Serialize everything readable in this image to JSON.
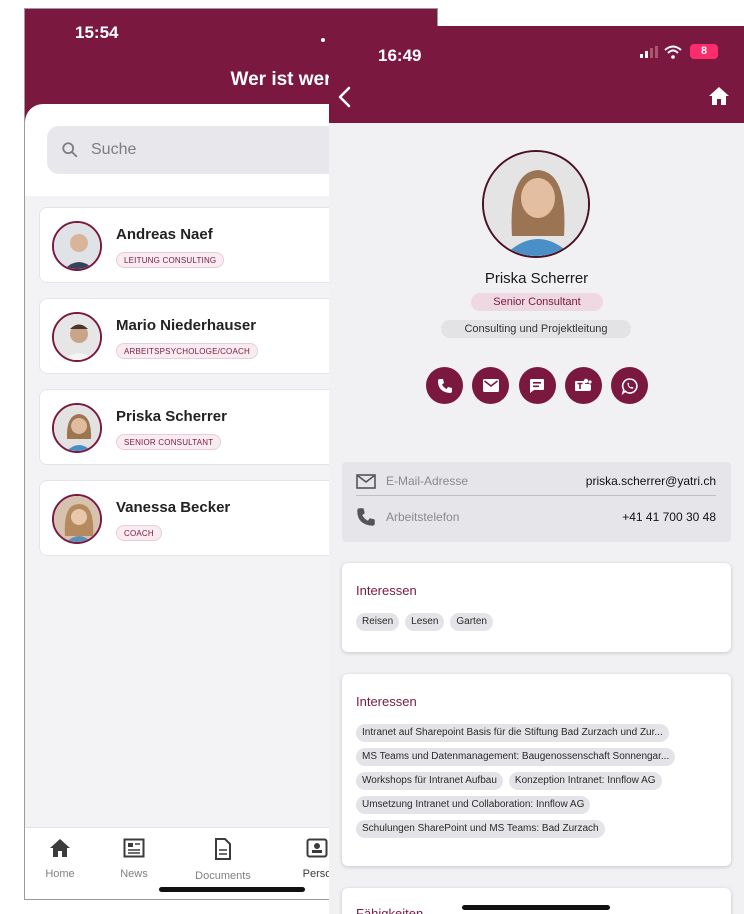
{
  "list_screen": {
    "time": "15:54",
    "title": "Wer ist wer",
    "search": {
      "placeholder": "Suche"
    },
    "people": [
      {
        "name": "Andreas Naef",
        "role": "LEITUNG CONSULTING"
      },
      {
        "name": "Mario Niederhauser",
        "role": "ARBEITSPSYCHOLOGE/COACH"
      },
      {
        "name": "Priska Scherrer",
        "role": "SENIOR CONSULTANT"
      },
      {
        "name": "Vanessa Becker",
        "role": "COACH"
      }
    ],
    "tabs": [
      {
        "label": "Home",
        "icon": "home-icon"
      },
      {
        "label": "News",
        "icon": "news-icon"
      },
      {
        "label": "Documents",
        "icon": "document-icon"
      },
      {
        "label": "Perso",
        "icon": "person-card-icon"
      }
    ]
  },
  "detail_screen": {
    "time": "16:49",
    "battery": "8",
    "profile": {
      "name": "Priska Scherrer",
      "role": "Senior Consultant",
      "department": "Consulting und Projektleitung"
    },
    "actions": [
      "phone-icon",
      "mail-icon",
      "chat-icon",
      "teams-icon",
      "whatsapp-icon"
    ],
    "contact": {
      "email_label": "E-Mail-Adresse",
      "email_value": "priska.scherrer@yatri.ch",
      "phone_label": "Arbeitstelefon",
      "phone_value": "+41 41 700 30 48"
    },
    "interests_1": {
      "title": "Interessen",
      "chips": [
        "Reisen",
        "Lesen",
        "Garten"
      ]
    },
    "interests_2": {
      "title": "Interessen",
      "chips": [
        "Intranet auf Sharepoint Basis für die Stiftung Bad Zurzach und Zur...",
        "MS Teams und Datenmanagement: Baugenossenschaft Sonnengar...",
        "Workshops für Intranet Aufbau",
        "Konzeption Intranet: Innflow AG",
        "Umsetzung Intranet und Collaboration: Innflow AG",
        "Schulungen SharePoint und MS Teams: Bad Zurzach"
      ]
    },
    "abilities": {
      "title": "Fähigkeiten"
    }
  },
  "colors": {
    "brand": "#7a1840",
    "chip_bg": "#e4e4e8",
    "role_bg": "#eed8e1"
  }
}
